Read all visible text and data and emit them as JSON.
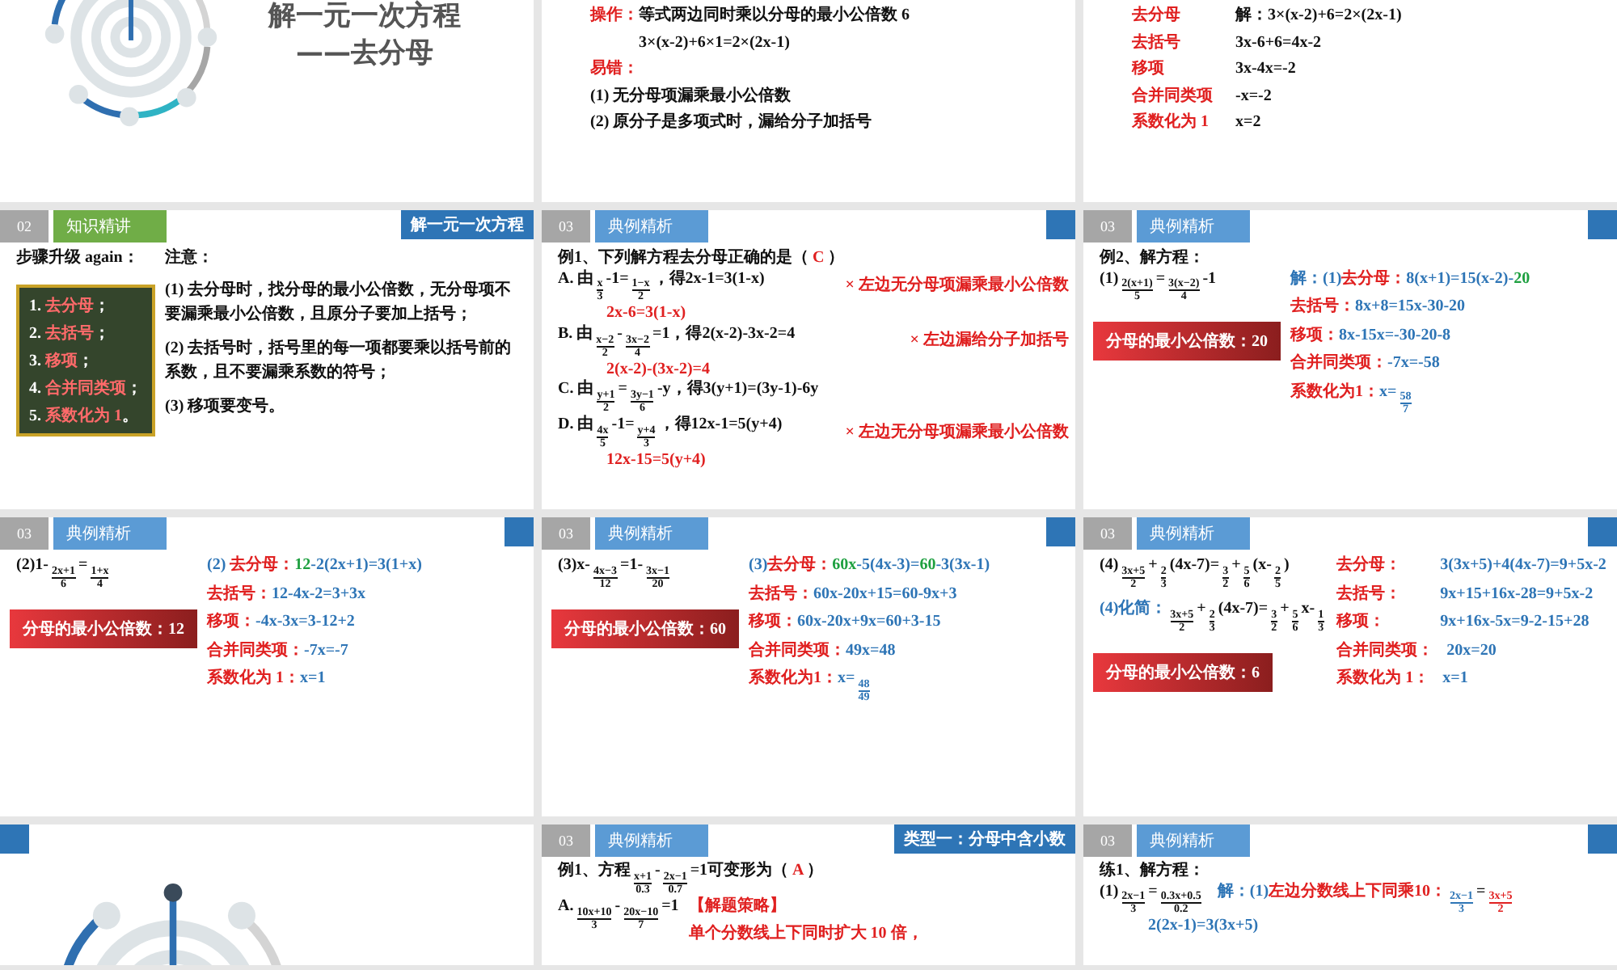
{
  "slides": [
    {
      "kind": "cover",
      "title": "解一元一次方程",
      "subtitle": "——去分母"
    },
    {
      "kind": "content",
      "items": [
        {
          "kind": "line",
          "parts": [
            {
              "kind": "text",
              "segs": [
                {
                  "t": "操作：",
                  "color": "#e02020"
                },
                "等式两边同时乘以分母的最小公倍数 6"
              ]
            }
          ]
        },
        {
          "kind": "subline",
          "parts": [
            {
              "kind": "text",
              "segs": [
                "3×(x-2)+6×1=2×(2x-1)"
              ]
            }
          ]
        },
        {
          "kind": "line",
          "parts": [
            {
              "kind": "text",
              "segs": [
                {
                  "t": "易错：",
                  "color": "#e02020"
                }
              ]
            }
          ]
        },
        {
          "kind": "line",
          "parts": [
            {
              "kind": "text",
              "segs": [
                "(1) 无分母项漏乘最小公倍数"
              ]
            }
          ]
        },
        {
          "kind": "line",
          "parts": [
            {
              "kind": "text",
              "segs": [
                "(2) 原分子是多项式时，漏给分子加括号"
              ]
            }
          ]
        }
      ]
    },
    {
      "kind": "content",
      "items": [
        {
          "kind": "line",
          "parts": [
            {
              "kind": "label",
              "segs": [
                {
                  "t": "去分母",
                  "color": "#e02020"
                }
              ]
            },
            {
              "kind": "text",
              "segs": [
                "解：3×(x-2)+6=2×(2x-1)"
              ]
            }
          ]
        },
        {
          "kind": "line",
          "parts": [
            {
              "kind": "label",
              "segs": [
                {
                  "t": "去括号",
                  "color": "#e02020"
                }
              ]
            },
            {
              "kind": "text",
              "segs": [
                "3x-6+6=4x-2"
              ]
            }
          ]
        },
        {
          "kind": "line",
          "parts": [
            {
              "kind": "label",
              "segs": [
                {
                  "t": "移项",
                  "color": "#e02020"
                }
              ]
            },
            {
              "kind": "text",
              "segs": [
                "3x-4x=-2"
              ]
            }
          ]
        },
        {
          "kind": "line",
          "parts": [
            {
              "kind": "label",
              "segs": [
                {
                  "t": "合并同类项",
                  "color": "#e02020"
                }
              ]
            },
            {
              "kind": "text",
              "segs": [
                "-x=-2"
              ]
            }
          ]
        },
        {
          "kind": "line",
          "parts": [
            {
              "kind": "label",
              "segs": [
                {
                  "t": "系数化为 1",
                  "color": "#e02020"
                }
              ]
            },
            {
              "kind": "text",
              "segs": [
                "x=2"
              ]
            }
          ]
        }
      ]
    },
    {
      "kind": "content",
      "header": {
        "number": "02",
        "tab": "知识精讲",
        "color": "#70ad47"
      },
      "corner": "解一元一次方程",
      "items": [
        {
          "kind": "columns",
          "columns": [
            [
              {
                "kind": "line",
                "parts": [
                  {
                    "kind": "text",
                    "segs": [
                      "步骤升级 again："
                    ]
                  }
                ]
              },
              {
                "kind": "box",
                "lines": [
                  [
                    {
                      "t": "1. ",
                      "color": "#ffffff"
                    },
                    {
                      "t": "去分母",
                      "color": "#ff6a6a"
                    },
                    {
                      "t": "；",
                      "color": "#ffffff"
                    }
                  ],
                  [
                    {
                      "t": "2. ",
                      "color": "#ffffff"
                    },
                    {
                      "t": "去括号",
                      "color": "#ff6a6a"
                    },
                    {
                      "t": "；",
                      "color": "#ffffff"
                    }
                  ],
                  [
                    {
                      "t": "3. ",
                      "color": "#ffffff"
                    },
                    {
                      "t": "移项",
                      "color": "#ff6a6a"
                    },
                    {
                      "t": "；",
                      "color": "#ffffff"
                    }
                  ],
                  [
                    {
                      "t": "4. ",
                      "color": "#ffffff"
                    },
                    {
                      "t": "合并同类项",
                      "color": "#ff6a6a"
                    },
                    {
                      "t": "；",
                      "color": "#ffffff"
                    }
                  ],
                  [
                    {
                      "t": "5. ",
                      "color": "#ffffff"
                    },
                    {
                      "t": "系数化为 1",
                      "color": "#ff6a6a"
                    },
                    {
                      "t": "。",
                      "color": "#ffffff"
                    }
                  ]
                ]
              }
            ],
            [
              {
                "kind": "line",
                "parts": [
                  {
                    "kind": "text",
                    "segs": [
                      "注意："
                    ]
                  }
                ]
              },
              {
                "kind": "para",
                "parts": [
                  {
                    "kind": "text",
                    "segs": [
                      "(1) 去分母时，找分母的最小公倍数，无分母项不要漏乘最小公倍数，且原分子要加上括号；"
                    ]
                  }
                ]
              },
              {
                "kind": "para",
                "parts": [
                  {
                    "kind": "text",
                    "segs": [
                      "(2) 去括号时，括号里的每一项都要乘以括号前的系数，且不要漏乘系数的符号；"
                    ]
                  }
                ]
              },
              {
                "kind": "para",
                "parts": [
                  {
                    "kind": "text",
                    "segs": [
                      "(3) 移项要变号。"
                    ]
                  }
                ]
              }
            ]
          ]
        }
      ]
    },
    {
      "kind": "content",
      "header": {
        "number": "03",
        "tab": "典例精析",
        "color": "#5b9bd5"
      },
      "corner_block": true,
      "items": [
        {
          "kind": "line",
          "parts": [
            {
              "kind": "text",
              "segs": [
                "例1、下列解方程去分母正确的是（ ",
                {
                  "t": "C",
                  "color": "#e02020"
                },
                " ）"
              ]
            }
          ]
        },
        {
          "kind": "line",
          "parts": [
            {
              "kind": "text",
              "segs": [
                "A. 由",
                {
                  "num": "x",
                  "den": "3"
                },
                "-1=",
                {
                  "num": "1−x",
                  "den": "2"
                },
                "，得2x-1=3(1-x)"
              ]
            },
            {
              "kind": "note",
              "segs": [
                {
                  "t": "×  左边无分母项漏乘最小公倍数",
                  "color": "#e02020"
                }
              ]
            }
          ]
        },
        {
          "kind": "subline",
          "parts": [
            {
              "kind": "text",
              "segs": [
                {
                  "t": "2x-6=3(1-x)",
                  "color": "#e02020"
                }
              ]
            }
          ]
        },
        {
          "kind": "line",
          "parts": [
            {
              "kind": "text",
              "segs": [
                "B. 由",
                {
                  "num": "x−2",
                  "den": "2"
                },
                "-",
                {
                  "num": "3x−2",
                  "den": "4"
                },
                "=1，得2(x-2)-3x-2=4"
              ]
            },
            {
              "kind": "note",
              "segs": [
                {
                  "t": "×  左边漏给分子加括号",
                  "color": "#e02020"
                }
              ]
            }
          ]
        },
        {
          "kind": "subline",
          "parts": [
            {
              "kind": "text",
              "segs": [
                {
                  "t": "2(x-2)-(3x-2)=4",
                  "color": "#e02020"
                }
              ]
            }
          ]
        },
        {
          "kind": "line",
          "parts": [
            {
              "kind": "text",
              "segs": [
                "C. 由",
                {
                  "num": "y+1",
                  "den": "2"
                },
                "=",
                {
                  "num": "3y−1",
                  "den": "6"
                },
                "-y，得3(y+1)=(3y-1)-6y"
              ]
            }
          ]
        },
        {
          "kind": "line",
          "parts": [
            {
              "kind": "text",
              "segs": [
                "D. 由",
                {
                  "num": "4x",
                  "den": "5"
                },
                "-1=",
                {
                  "num": "y+4",
                  "den": "3"
                },
                "，得12x-1=5(y+4)"
              ]
            },
            {
              "kind": "note",
              "segs": [
                {
                  "t": "×  左边无分母项漏乘最小公倍数",
                  "color": "#e02020"
                }
              ]
            }
          ]
        },
        {
          "kind": "subline",
          "parts": [
            {
              "kind": "text",
              "segs": [
                {
                  "t": "12x-15=5(y+4)",
                  "color": "#e02020"
                }
              ]
            }
          ]
        }
      ]
    },
    {
      "kind": "content",
      "header": {
        "number": "03",
        "tab": "典例精析",
        "color": "#5b9bd5"
      },
      "corner_block": true,
      "items": [
        {
          "kind": "line",
          "parts": [
            {
              "kind": "text",
              "segs": [
                "例2、解方程："
              ]
            }
          ]
        },
        {
          "kind": "columns",
          "columns": [
            [
              {
                "kind": "line",
                "parts": [
                  {
                    "kind": "text",
                    "segs": [
                      "(1)",
                      {
                        "num": "2(x+1)",
                        "den": "5"
                      },
                      "=",
                      {
                        "num": "3(x−2)",
                        "den": "4"
                      },
                      "-1"
                    ]
                  }
                ]
              },
              {
                "kind": "badge",
                "segs": [
                  "分母的最小公倍数：",
                  "20"
                ]
              }
            ],
            [
              {
                "kind": "line",
                "parts": [
                  {
                    "kind": "text",
                    "segs": [
                      {
                        "t": "解：(1)",
                        "color": "#2e75b6"
                      },
                      {
                        "t": "去分母：",
                        "color": "#e02020"
                      },
                      {
                        "t": "8(x+1)=15(x-2)-",
                        "color": "#2e75b6"
                      },
                      {
                        "t": "20",
                        "color": "#1ea040"
                      }
                    ]
                  }
                ]
              },
              {
                "kind": "line",
                "parts": [
                  {
                    "kind": "text",
                    "segs": [
                      {
                        "t": "去括号：",
                        "color": "#e02020"
                      },
                      {
                        "t": "8x+8=15x-30-20",
                        "color": "#2e75b6"
                      }
                    ]
                  }
                ]
              },
              {
                "kind": "line",
                "parts": [
                  {
                    "kind": "text",
                    "segs": [
                      {
                        "t": "移项：",
                        "color": "#e02020"
                      },
                      {
                        "t": "8x-15x=-30-20-8",
                        "color": "#2e75b6"
                      }
                    ]
                  }
                ]
              },
              {
                "kind": "line",
                "parts": [
                  {
                    "kind": "text",
                    "segs": [
                      {
                        "t": "合并同类项：",
                        "color": "#e02020"
                      },
                      {
                        "t": "-7x=-58",
                        "color": "#2e75b6"
                      }
                    ]
                  }
                ]
              },
              {
                "kind": "line",
                "parts": [
                  {
                    "kind": "text",
                    "segs": [
                      {
                        "t": "系数化为1：",
                        "color": "#e02020"
                      },
                      {
                        "t": "x=",
                        "color": "#2e75b6"
                      },
                      {
                        "num": "58",
                        "den": "7",
                        "color": "#2e75b6"
                      }
                    ]
                  }
                ]
              }
            ]
          ]
        }
      ]
    },
    {
      "kind": "content",
      "header": {
        "number": "03",
        "tab": "典例精析",
        "color": "#5b9bd5"
      },
      "corner_block": true,
      "items": [
        {
          "kind": "columns",
          "columns": [
            [
              {
                "kind": "line",
                "parts": [
                  {
                    "kind": "text",
                    "segs": [
                      "(2)1-",
                      {
                        "num": "2x+1",
                        "den": "6"
                      },
                      "=",
                      {
                        "num": "1+x",
                        "den": "4"
                      }
                    ]
                  }
                ]
              },
              {
                "kind": "badge",
                "segs": [
                  "分母的最小公倍数：",
                  "12"
                ]
              }
            ],
            [
              {
                "kind": "line",
                "parts": [
                  {
                    "kind": "text",
                    "segs": [
                      {
                        "t": "(2) ",
                        "color": "#2e75b6"
                      },
                      {
                        "t": "去分母：",
                        "color": "#e02020"
                      },
                      {
                        "t": "12",
                        "color": "#1ea040"
                      },
                      {
                        "t": "-2(2x+1)=3(1+x)",
                        "color": "#2e75b6"
                      }
                    ]
                  }
                ]
              },
              {
                "kind": "line",
                "parts": [
                  {
                    "kind": "text",
                    "segs": [
                      {
                        "t": "去括号：",
                        "color": "#e02020"
                      },
                      {
                        "t": "12-4x-2=3+3x",
                        "color": "#2e75b6"
                      }
                    ]
                  }
                ]
              },
              {
                "kind": "line",
                "parts": [
                  {
                    "kind": "text",
                    "segs": [
                      {
                        "t": "移项：",
                        "color": "#e02020"
                      },
                      {
                        "t": "-4x-3x=3-12+2",
                        "color": "#2e75b6"
                      }
                    ]
                  }
                ]
              },
              {
                "kind": "line",
                "parts": [
                  {
                    "kind": "text",
                    "segs": [
                      {
                        "t": "合并同类项：",
                        "color": "#e02020"
                      },
                      {
                        "t": "-7x=-7",
                        "color": "#2e75b6"
                      }
                    ]
                  }
                ]
              },
              {
                "kind": "line",
                "parts": [
                  {
                    "kind": "text",
                    "segs": [
                      {
                        "t": "系数化为 1：",
                        "color": "#e02020"
                      },
                      {
                        "t": "x=1",
                        "color": "#2e75b6"
                      }
                    ]
                  }
                ]
              }
            ]
          ]
        }
      ]
    },
    {
      "kind": "content",
      "header": {
        "number": "03",
        "tab": "典例精析",
        "color": "#5b9bd5"
      },
      "corner_block": true,
      "items": [
        {
          "kind": "columns",
          "columns": [
            [
              {
                "kind": "line",
                "parts": [
                  {
                    "kind": "text",
                    "segs": [
                      "(3)x-",
                      {
                        "num": "4x−3",
                        "den": "12"
                      },
                      "=1-",
                      {
                        "num": "3x−1",
                        "den": "20"
                      }
                    ]
                  }
                ]
              },
              {
                "kind": "badge",
                "segs": [
                  "分母的最小公倍数：",
                  "60"
                ]
              }
            ],
            [
              {
                "kind": "line",
                "parts": [
                  {
                    "kind": "text",
                    "segs": [
                      {
                        "t": "(3)",
                        "color": "#2e75b6"
                      },
                      {
                        "t": "去分母：",
                        "color": "#e02020"
                      },
                      {
                        "t": "60x",
                        "color": "#1ea040"
                      },
                      {
                        "t": "-5(4x-3)=",
                        "color": "#2e75b6"
                      },
                      {
                        "t": "60",
                        "color": "#1ea040"
                      },
                      {
                        "t": "-3(3x-1)",
                        "color": "#2e75b6"
                      }
                    ]
                  }
                ]
              },
              {
                "kind": "line",
                "parts": [
                  {
                    "kind": "text",
                    "segs": [
                      {
                        "t": "去括号：",
                        "color": "#e02020"
                      },
                      {
                        "t": "60x-20x+15=60-9x+3",
                        "color": "#2e75b6"
                      }
                    ]
                  }
                ]
              },
              {
                "kind": "line",
                "parts": [
                  {
                    "kind": "text",
                    "segs": [
                      {
                        "t": "移项：",
                        "color": "#e02020"
                      },
                      {
                        "t": "60x-20x+9x=60+3-15",
                        "color": "#2e75b6"
                      }
                    ]
                  }
                ]
              },
              {
                "kind": "line",
                "parts": [
                  {
                    "kind": "text",
                    "segs": [
                      {
                        "t": "合并同类项：",
                        "color": "#e02020"
                      },
                      {
                        "t": "49x=48",
                        "color": "#2e75b6"
                      }
                    ]
                  }
                ]
              },
              {
                "kind": "line",
                "parts": [
                  {
                    "kind": "text",
                    "segs": [
                      {
                        "t": "系数化为1：",
                        "color": "#e02020"
                      },
                      {
                        "t": "x=",
                        "color": "#2e75b6"
                      },
                      {
                        "num": "48",
                        "den": "49",
                        "color": "#2e75b6"
                      }
                    ]
                  }
                ]
              }
            ]
          ]
        }
      ]
    },
    {
      "kind": "content",
      "header": {
        "number": "03",
        "tab": "典例精析",
        "color": "#5b9bd5"
      },
      "corner_block": true,
      "items": [
        {
          "kind": "columns",
          "columns": [
            [
              {
                "kind": "line",
                "parts": [
                  {
                    "kind": "text",
                    "segs": [
                      "(4)",
                      {
                        "num": "3x+5",
                        "den": "2"
                      },
                      "+",
                      {
                        "num": "2",
                        "den": "3"
                      },
                      "(4x-7)=",
                      {
                        "num": "3",
                        "den": "2"
                      },
                      "+",
                      {
                        "num": "5",
                        "den": "6"
                      },
                      "(x-",
                      {
                        "num": "2",
                        "den": "5"
                      },
                      ")"
                    ]
                  }
                ]
              },
              {
                "kind": "line",
                "parts": [
                  {
                    "kind": "text",
                    "segs": [
                      {
                        "t": "(4)化简：",
                        "color": "#2e75b6"
                      },
                      {
                        "num": "3x+5",
                        "den": "2"
                      },
                      "+",
                      {
                        "num": "2",
                        "den": "3"
                      },
                      "(4x-7)=",
                      {
                        "num": "3",
                        "den": "2"
                      },
                      "+",
                      {
                        "num": "5",
                        "den": "6"
                      },
                      "x-",
                      {
                        "num": "1",
                        "den": "3"
                      }
                    ]
                  }
                ]
              },
              {
                "kind": "badge",
                "segs": [
                  "分母的最小公倍数：",
                  "6"
                ]
              }
            ],
            [
              {
                "kind": "line",
                "parts": [
                  {
                    "kind": "label",
                    "segs": [
                      {
                        "t": "去分母：",
                        "color": "#e02020"
                      }
                    ]
                  },
                  {
                    "kind": "text",
                    "segs": [
                      {
                        "t": "3(3x+5)+4(4x-7)=9+5x-2",
                        "color": "#2e75b6"
                      }
                    ]
                  }
                ]
              },
              {
                "kind": "line",
                "parts": [
                  {
                    "kind": "label",
                    "segs": [
                      {
                        "t": "去括号：",
                        "color": "#e02020"
                      }
                    ]
                  },
                  {
                    "kind": "text",
                    "segs": [
                      {
                        "t": "9x+15+16x-28=9+5x-2",
                        "color": "#2e75b6"
                      }
                    ]
                  }
                ]
              },
              {
                "kind": "line",
                "parts": [
                  {
                    "kind": "label",
                    "segs": [
                      {
                        "t": "移项：",
                        "color": "#e02020"
                      }
                    ]
                  },
                  {
                    "kind": "text",
                    "segs": [
                      {
                        "t": "9x+16x-5x=9-2-15+28",
                        "color": "#2e75b6"
                      }
                    ]
                  }
                ]
              },
              {
                "kind": "line",
                "parts": [
                  {
                    "kind": "label",
                    "segs": [
                      {
                        "t": "合并同类项：",
                        "color": "#e02020"
                      }
                    ]
                  },
                  {
                    "kind": "text",
                    "segs": [
                      {
                        "t": "20x=20",
                        "color": "#2e75b6"
                      }
                    ]
                  }
                ]
              },
              {
                "kind": "line",
                "parts": [
                  {
                    "kind": "label",
                    "segs": [
                      {
                        "t": "系数化为 1：",
                        "color": "#e02020"
                      }
                    ]
                  },
                  {
                    "kind": "text",
                    "segs": [
                      {
                        "t": "x=1",
                        "color": "#2e75b6"
                      }
                    ]
                  }
                ]
              }
            ]
          ]
        }
      ]
    },
    {
      "kind": "cover",
      "corner_block": true
    },
    {
      "kind": "content",
      "header": {
        "number": "03",
        "tab": "典例精析",
        "color": "#5b9bd5"
      },
      "corner": "类型一：分母中含小数",
      "items": [
        {
          "kind": "line",
          "parts": [
            {
              "kind": "text",
              "segs": [
                "例1、方程",
                {
                  "num": "x+1",
                  "den": "0.3"
                },
                "-",
                {
                  "num": "2x−1",
                  "den": "0.7"
                },
                "=1可变形为（ ",
                {
                  "t": "A",
                  "color": "#e02020"
                },
                " ）"
              ]
            }
          ]
        },
        {
          "kind": "columns",
          "columns": [
            [
              {
                "kind": "line",
                "parts": [
                  {
                    "kind": "text",
                    "segs": [
                      "A.",
                      {
                        "num": "10x+10",
                        "den": "3"
                      },
                      "-",
                      {
                        "num": "20x−10",
                        "den": "7"
                      },
                      "=1"
                    ]
                  }
                ]
              }
            ],
            [
              {
                "kind": "line",
                "parts": [
                  {
                    "kind": "text",
                    "segs": [
                      {
                        "t": "【解题策略】",
                        "color": "#e02020"
                      }
                    ]
                  }
                ]
              },
              {
                "kind": "line",
                "parts": [
                  {
                    "kind": "text",
                    "segs": [
                      {
                        "t": "单个分数线上下同时扩大 10 倍，",
                        "color": "#e02020"
                      }
                    ]
                  }
                ]
              }
            ]
          ]
        }
      ]
    },
    {
      "kind": "content",
      "header": {
        "number": "03",
        "tab": "典例精析",
        "color": "#5b9bd5"
      },
      "corner_block": true,
      "items": [
        {
          "kind": "line",
          "parts": [
            {
              "kind": "text",
              "segs": [
                "练1、解方程："
              ]
            }
          ]
        },
        {
          "kind": "line",
          "parts": [
            {
              "kind": "text",
              "segs": [
                "(1)",
                {
                  "num": "2x−1",
                  "den": "3"
                },
                "=",
                {
                  "num": "0.3x+0.5",
                  "den": "0.2"
                }
              ]
            },
            {
              "kind": "text",
              "segs": [
                {
                  "t": "解：(1)",
                  "color": "#2e75b6"
                },
                {
                  "t": "左边分数线上下同乘10：",
                  "color": "#e02020"
                },
                {
                  "num": "2x−1",
                  "den": "3",
                  "color": "#2e75b6"
                },
                "=",
                {
                  "num": "3x+5",
                  "den": "2",
                  "color": "#e02020"
                }
              ]
            }
          ]
        },
        {
          "kind": "subline",
          "parts": [
            {
              "kind": "text",
              "segs": [
                {
                  "t": "2(2x-1)=3(3x+5)",
                  "color": "#2e75b6"
                }
              ]
            }
          ]
        }
      ]
    }
  ]
}
